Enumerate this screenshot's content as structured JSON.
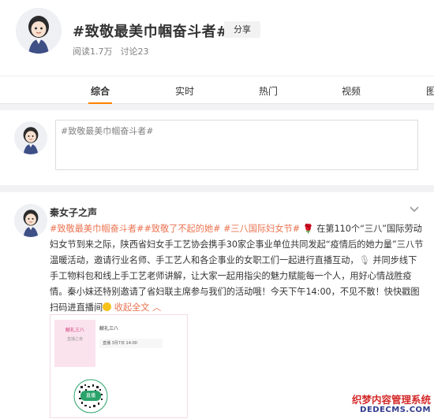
{
  "header": {
    "title": "#致敬最美巾帼奋斗者#",
    "share_label": "分享",
    "reads": "阅读1.7万",
    "discussions": "讨论23"
  },
  "tabs": [
    {
      "label": "综合",
      "active": true
    },
    {
      "label": "实时",
      "active": false
    },
    {
      "label": "热门",
      "active": false
    },
    {
      "label": "视频",
      "active": false
    },
    {
      "label": "图",
      "active": false
    }
  ],
  "composer": {
    "text": "#致敬最美巾帼奋斗者#"
  },
  "post": {
    "author": "秦女子之声",
    "tag1": "#致敬最美巾帼奋斗者#",
    "tag2": "#致敬了不起的她#",
    "tag3": "#三八国际妇女节#",
    "body1": "在第110个“三八”国际劳动妇女节到来之际，陕西省妇女手工艺协会携手30家企事业单位共同发起“疫情后的她力量”三八节温暖活动，邀请行业名师、手工艺人和各企事业的女职工们一起进行直播互动，",
    "body2": "并同步线下手工物料包和线上手工艺老师讲解，让大家一起用指尖的魅力赋能每一个人，用好心情战胜疫情。秦小妹还特别邀请了省妇联主席参与我们的活动哦！今天下午14:00，不见不散！快快戳图扫码进直播间",
    "expand_label": "收起全文",
    "poster": {
      "left_title": "献礼三八",
      "left_sub": "直播之夜",
      "right_title": "献礼三八",
      "date": "直播  3月7日  14:00",
      "live_badge": "直播",
      "qr_caption": ""
    }
  },
  "watermark": {
    "cn": "织梦内容管理系统",
    "en": "DEDECMS.COM"
  },
  "colors": {
    "accent": "#ff8200",
    "tag": "#eb7350",
    "live": "#2aa36b"
  }
}
